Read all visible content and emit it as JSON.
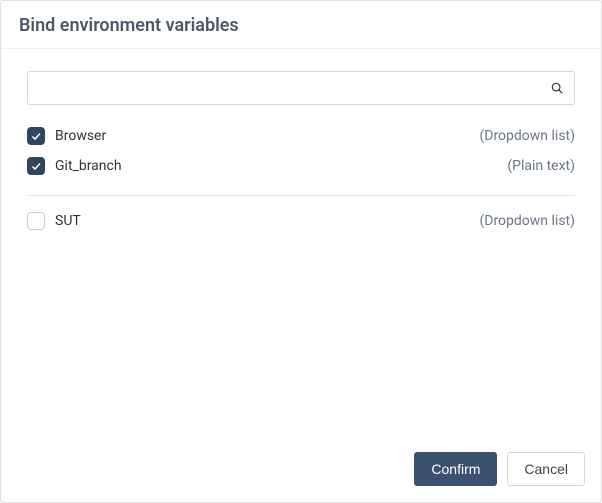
{
  "header": {
    "title": "Bind environment variables"
  },
  "search": {
    "value": "",
    "placeholder": ""
  },
  "groups": [
    {
      "items": [
        {
          "label": "Browser",
          "type": "(Dropdown list)",
          "checked": true
        },
        {
          "label": "Git_branch",
          "type": "(Plain text)",
          "checked": true
        }
      ]
    },
    {
      "items": [
        {
          "label": "SUT",
          "type": "(Dropdown list)",
          "checked": false
        }
      ]
    }
  ],
  "footer": {
    "confirm": "Confirm",
    "cancel": "Cancel"
  }
}
